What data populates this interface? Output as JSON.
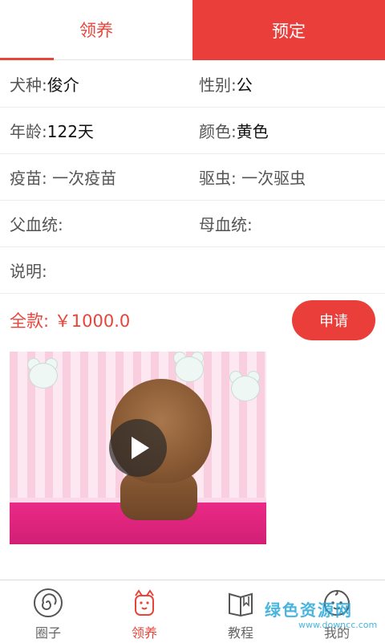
{
  "tabs": {
    "adopt": "领养",
    "reserve": "预定"
  },
  "details": {
    "breed_label": "犬种:",
    "breed_value": "俊介",
    "gender_label": "性别:",
    "gender_value": "公",
    "age_label": "年龄:",
    "age_value": "122天",
    "color_label": "颜色:",
    "color_value": "黄色",
    "vaccine_label": "疫苗:",
    "vaccine_value": " 一次疫苗",
    "deworm_label": "驱虫:",
    "deworm_value": " 一次驱虫",
    "father_label": "父血统:",
    "father_value": "",
    "mother_label": "母血统:",
    "mother_value": "",
    "note_label": "说明:",
    "note_value": ""
  },
  "price": {
    "label": "全款:",
    "value": "￥1000.0"
  },
  "apply_button": "申请",
  "nav": [
    {
      "label": "圈子",
      "icon": "circle-spiral-icon"
    },
    {
      "label": "领养",
      "icon": "puppy-icon"
    },
    {
      "label": "教程",
      "icon": "book-icon"
    },
    {
      "label": "我的",
      "icon": "profile-face-icon"
    }
  ],
  "watermark": {
    "brand": "绿色资源网",
    "url": "www.downcc.com"
  },
  "colors": {
    "accent": "#ea3e3a",
    "price": "#e8443a",
    "divider": "#ececec"
  }
}
